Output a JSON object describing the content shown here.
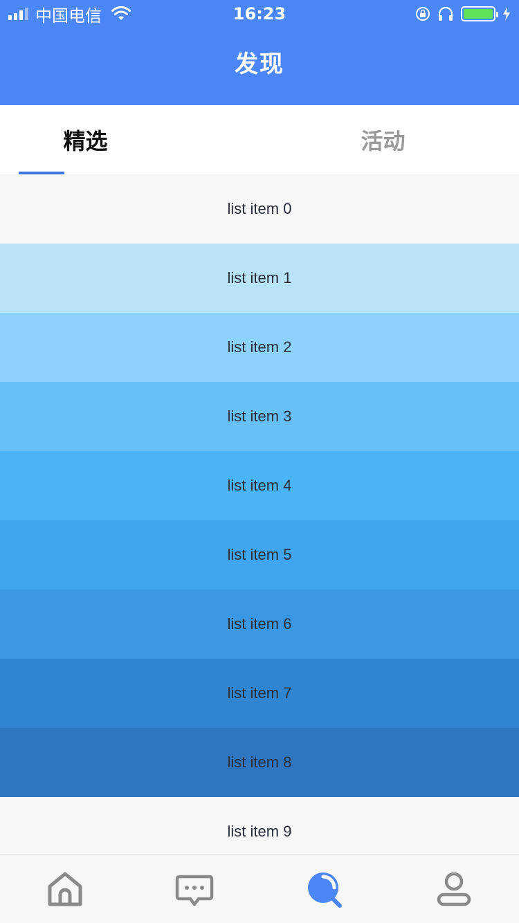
{
  "status_bar": {
    "carrier": "中国电信",
    "time": "16:23"
  },
  "header": {
    "title": "发现"
  },
  "tabs": [
    {
      "label": "精选",
      "active": true
    },
    {
      "label": "活动",
      "active": false
    }
  ],
  "list": {
    "items": [
      {
        "label": "list item 0",
        "color": "#f7f7f7"
      },
      {
        "label": "list item 1",
        "color": "#b8e3f9"
      },
      {
        "label": "list item 2",
        "color": "#8dd2fa"
      },
      {
        "label": "list item 3",
        "color": "#68c1f6"
      },
      {
        "label": "list item 4",
        "color": "#4ab4f5"
      },
      {
        "label": "list item 5",
        "color": "#3fa5ee"
      },
      {
        "label": "list item 6",
        "color": "#3997e3"
      },
      {
        "label": "list item 7",
        "color": "#3085d0"
      },
      {
        "label": "list item 8",
        "color": "#2e76bf"
      },
      {
        "label": "list item 9",
        "color": "#f7f7f7"
      }
    ]
  },
  "tab_bar": {
    "items": [
      {
        "icon": "home-icon",
        "active": false
      },
      {
        "icon": "message-icon",
        "active": false
      },
      {
        "icon": "discover-icon",
        "active": true
      },
      {
        "icon": "profile-icon",
        "active": false
      }
    ]
  },
  "colors": {
    "primary": "#4a86f5",
    "tab_indicator": "#3a78e6",
    "icon_inactive": "#8a8a8a",
    "icon_active": "#4a86f5",
    "battery": "#5fe35b"
  }
}
